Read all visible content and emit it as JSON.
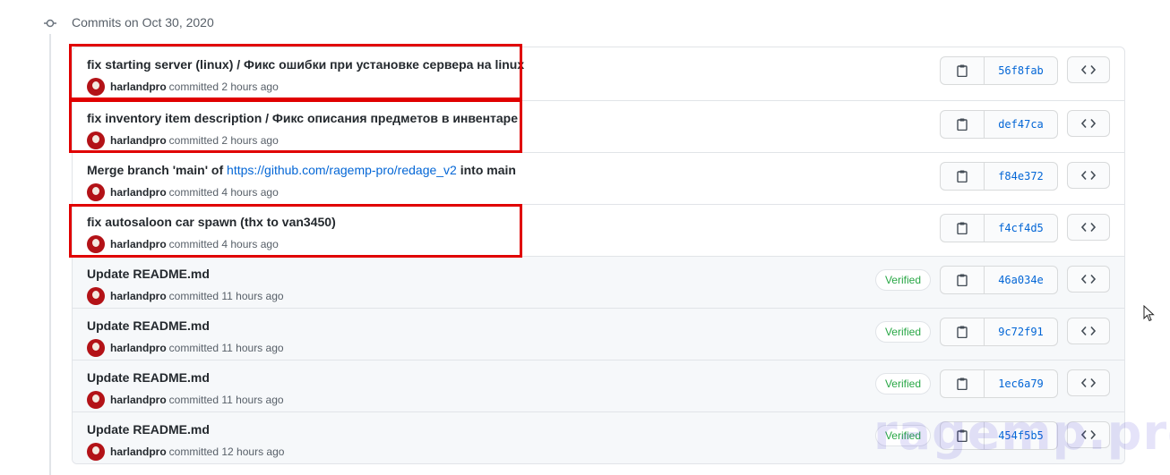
{
  "group": {
    "title": "Commits on Oct 30, 2020"
  },
  "commits": [
    {
      "title": "fix starting server (linux) / Фикс ошибки при установке сервера на linux",
      "author": "harlandpro",
      "action": "committed",
      "time": "2 hours ago",
      "verified": "",
      "sha": "56f8fab"
    },
    {
      "title": "fix inventory item description / Фикс описания предметов в инвентаре",
      "author": "harlandpro",
      "action": "committed",
      "time": "2 hours ago",
      "verified": "",
      "sha": "def47ca"
    },
    {
      "title_pre": "Merge branch 'main' of ",
      "title_link": "https://github.com/ragemp-pro/redage_v2",
      "title_post": " into main",
      "author": "harlandpro",
      "action": "committed",
      "time": "4 hours ago",
      "verified": "",
      "sha": "f84e372"
    },
    {
      "title": "fix autosaloon car spawn (thx to van3450)",
      "author": "harlandpro",
      "action": "committed",
      "time": "4 hours ago",
      "verified": "",
      "sha": "f4cf4d5"
    },
    {
      "title": "Update README.md",
      "author": "harlandpro",
      "action": "committed",
      "time": "11 hours ago",
      "verified": "Verified",
      "sha": "46a034e"
    },
    {
      "title": "Update README.md",
      "author": "harlandpro",
      "action": "committed",
      "time": "11 hours ago",
      "verified": "Verified",
      "sha": "9c72f91"
    },
    {
      "title": "Update README.md",
      "author": "harlandpro",
      "action": "committed",
      "time": "11 hours ago",
      "verified": "Verified",
      "sha": "1ec6a79"
    },
    {
      "title": "Update README.md",
      "author": "harlandpro",
      "action": "committed",
      "time": "12 hours ago",
      "verified": "Verified",
      "sha": "454f5b5"
    }
  ],
  "watermark": "ragemp.pro",
  "icons": {
    "timeline": "commit-node-icon",
    "copy": "clipboard-icon",
    "browse": "code-icon",
    "cursor": "mouse-pointer-icon"
  },
  "colors": {
    "highlight": "#e00000",
    "link": "#0366d6",
    "verified": "#28a745"
  }
}
